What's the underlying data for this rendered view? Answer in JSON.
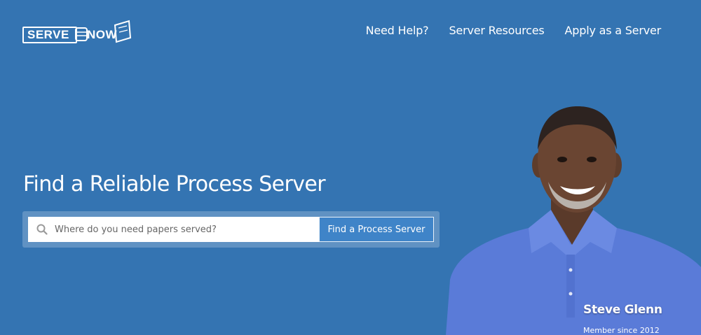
{
  "brand": {
    "logo_left": "SERVE",
    "logo_right": "NOW"
  },
  "nav": {
    "items": [
      "Need Help?",
      "Server Resources",
      "Apply as a Server"
    ]
  },
  "hero": {
    "title": "Find a Reliable Process Server",
    "search_placeholder": "Where do you need papers served?",
    "search_button": "Find a Process Server"
  },
  "testimonial": {
    "name": "Steve Glenn",
    "since": "Member since 2012"
  },
  "colors": {
    "background": "#3474b2",
    "button": "#3f84c8",
    "shirt": "#5a7bd8"
  },
  "icons": {
    "search": "search-icon",
    "logo_fist": "fist-icon",
    "logo_paper": "paper-icon"
  }
}
